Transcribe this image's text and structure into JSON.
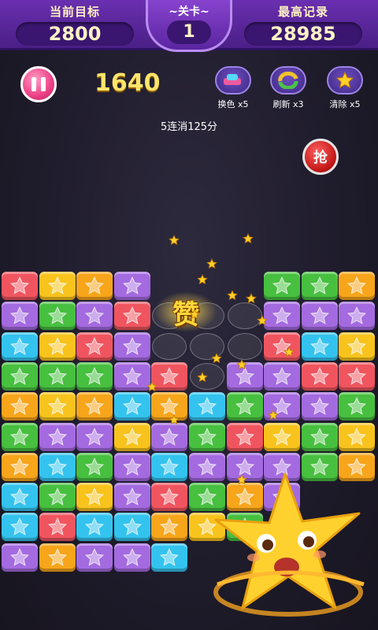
{
  "header": {
    "target_label": "当前目标",
    "target_value": "2800",
    "level_label": "~关卡~",
    "level_value": "1",
    "record_label": "最高记录",
    "record_value": "28985"
  },
  "score": "1640",
  "tools": [
    {
      "name": "color-swap",
      "label": "换色 x5",
      "icon": "color-swap-icon"
    },
    {
      "name": "refresh",
      "label": "刷新 x3",
      "icon": "refresh-icon"
    },
    {
      "name": "clear",
      "label": "清除 x5",
      "icon": "clear-star-icon"
    }
  ],
  "combo_text": "5连消125分",
  "grab_label": "抢",
  "praise_text": "赞",
  "colors": {
    "red": "#f0555f",
    "yellow": "#f8c31c",
    "purple": "#a46ae0",
    "blue": "#33c3ee",
    "green": "#47bf3f",
    "orange": "#f7a51a"
  },
  "board": {
    "rows": [
      [
        "red",
        "yellow",
        "orange",
        "purple",
        "empty",
        "empty",
        "empty",
        "green",
        "green",
        "orange"
      ],
      [
        "purple",
        "green",
        "purple",
        "red",
        "empty",
        "empty",
        "empty",
        "purple",
        "purple",
        "purple"
      ],
      [
        "blue",
        "yellow",
        "red",
        "purple",
        "empty",
        "empty",
        "empty",
        "red",
        "blue",
        "yellow"
      ],
      [
        "green",
        "green",
        "green",
        "purple",
        "red",
        "empty",
        "purple",
        "purple",
        "red",
        "red"
      ],
      [
        "orange",
        "yellow",
        "orange",
        "blue",
        "orange",
        "blue",
        "green",
        "purple",
        "purple",
        "green"
      ],
      [
        "green",
        "purple",
        "purple",
        "yellow",
        "purple",
        "green",
        "red",
        "yellow",
        "green",
        "yellow"
      ],
      [
        "orange",
        "blue",
        "green",
        "purple",
        "blue",
        "purple",
        "purple",
        "purple",
        "green",
        "orange"
      ],
      [
        "blue",
        "green",
        "yellow",
        "purple",
        "red",
        "green",
        "orange",
        "purple",
        "empty",
        "empty"
      ],
      [
        "blue",
        "red",
        "blue",
        "blue",
        "orange",
        "yellow",
        "green",
        "empty",
        "empty",
        "empty"
      ],
      [
        "purple",
        "orange",
        "purple",
        "purple",
        "blue",
        "empty",
        "empty",
        "empty",
        "empty",
        "empty"
      ]
    ]
  }
}
